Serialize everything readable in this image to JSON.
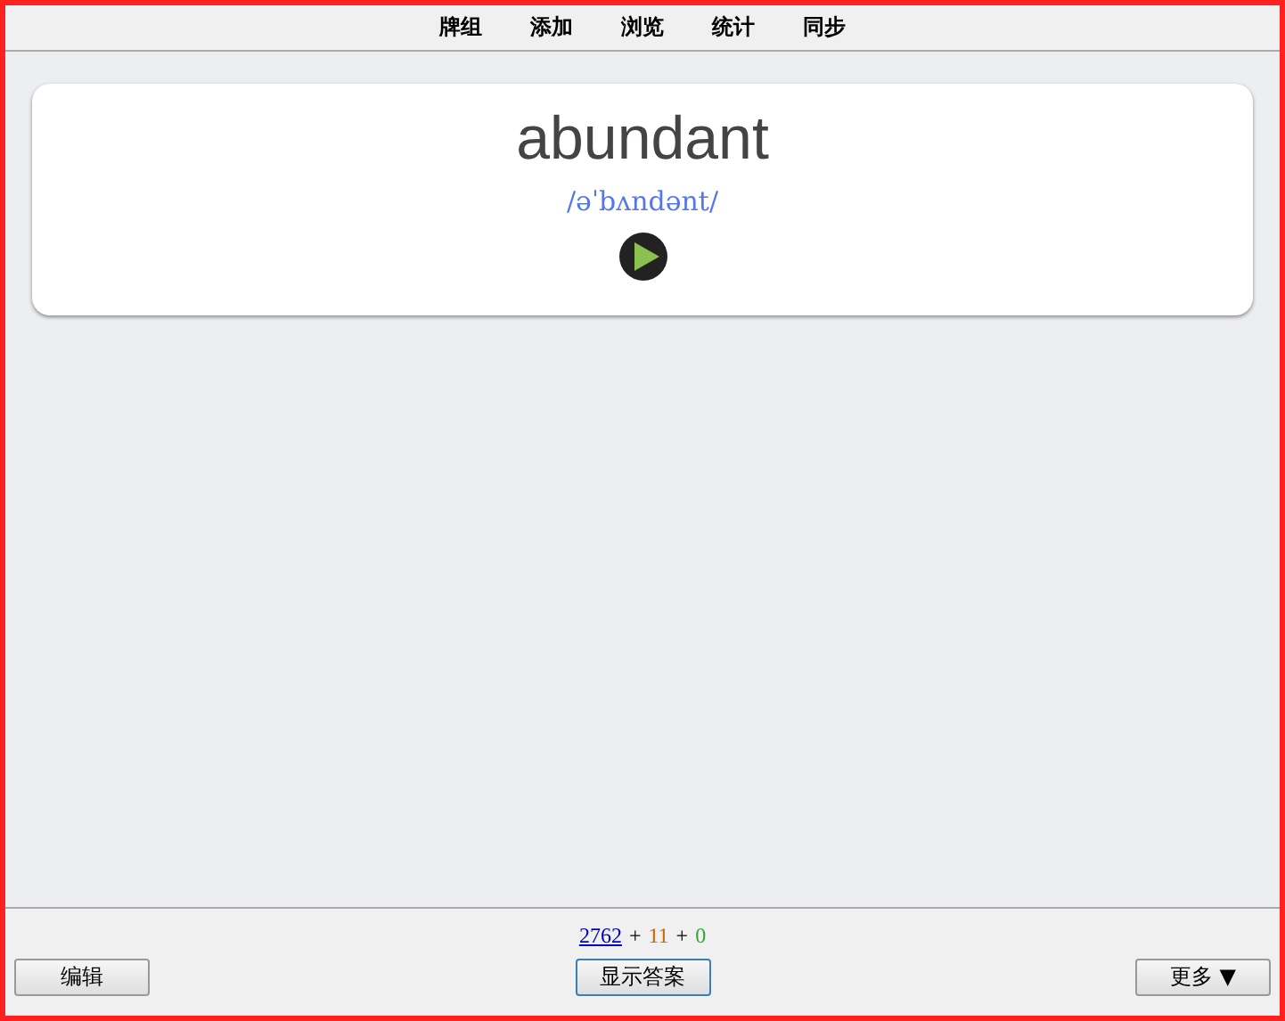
{
  "menu": [
    {
      "label": "牌组"
    },
    {
      "label": "添加"
    },
    {
      "label": "浏览"
    },
    {
      "label": "统计"
    },
    {
      "label": "同步"
    }
  ],
  "card": {
    "word": "abundant",
    "phonetic": "/əˈbʌndənt/"
  },
  "counts": [
    {
      "text": "2762",
      "kind": "link",
      "color": "#0000cc"
    },
    {
      "text": "+",
      "kind": "sep"
    },
    {
      "text": "11",
      "kind": "count",
      "color": "#cc6600"
    },
    {
      "text": "+",
      "kind": "sep"
    },
    {
      "text": "0",
      "kind": "count",
      "color": "#33aa33"
    }
  ],
  "buttons": {
    "edit": "编辑",
    "show_answer": "显示答案",
    "more": "更多 ▼"
  }
}
